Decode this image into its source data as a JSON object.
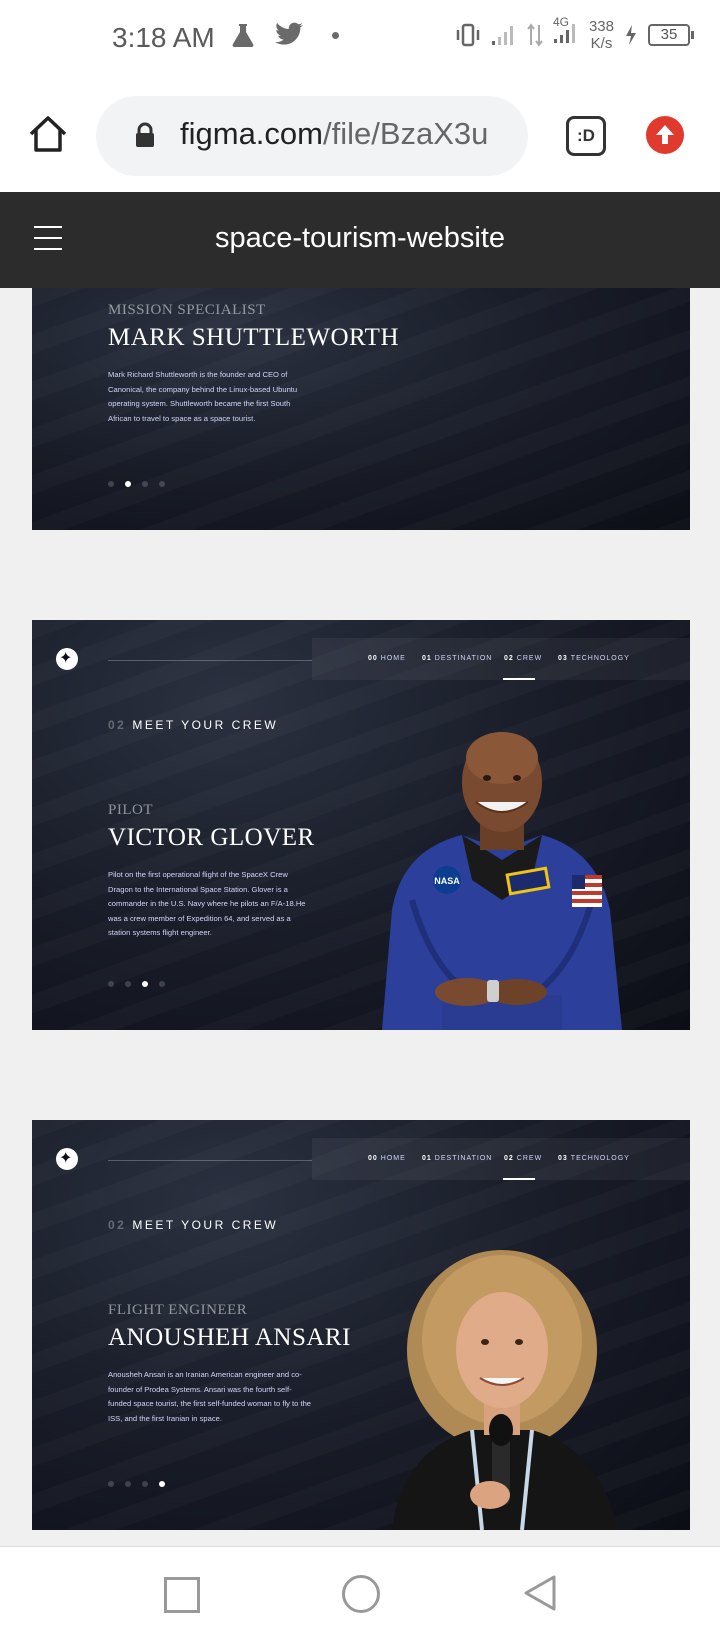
{
  "status_bar": {
    "time": "3:18 AM",
    "network_type": "4G",
    "net_speed_value": "338",
    "net_speed_unit": "K/s",
    "battery": "35"
  },
  "browser": {
    "url_host": "figma.com",
    "url_path": "/file/BzaX3u",
    "tab_switcher_label": ":D"
  },
  "figma": {
    "file_title": "space-tourism-website"
  },
  "nav": [
    {
      "num": "00",
      "label": "HOME"
    },
    {
      "num": "01",
      "label": "DESTINATION"
    },
    {
      "num": "02",
      "label": "CREW"
    },
    {
      "num": "03",
      "label": "TECHNOLOGY"
    }
  ],
  "frames": [
    {
      "role": "MISSION SPECIALIST",
      "name": "MARK SHUTTLEWORTH",
      "bio": "Mark Richard Shuttleworth is the founder and CEO of Canonical, the company behind the Linux-based Ubuntu operating system. Shuttleworth became the first South African to travel to space as a space tourist.",
      "active_index": 1
    },
    {
      "section_num": "02",
      "section_title": "MEET YOUR CREW",
      "role": "PILOT",
      "name": "VICTOR GLOVER",
      "bio": "Pilot on the first operational flight of the SpaceX Crew Dragon to the International Space Station. Glover is a commander in the U.S. Navy where he pilots an F/A-18.He was a crew member of Expedition 64, and served as a station systems flight engineer.",
      "active_index": 2,
      "badge_text": "NASA"
    },
    {
      "section_num": "02",
      "section_title": "MEET YOUR CREW",
      "role": "FLIGHT ENGINEER",
      "name": "ANOUSHEH ANSARI",
      "bio": "Anousheh Ansari is an Iranian American engineer and co-founder of Prodea Systems. Ansari was the fourth self-funded space tourist, the first self-funded woman to fly to the ISS, and the first Iranian in space.",
      "active_index": 3
    }
  ]
}
